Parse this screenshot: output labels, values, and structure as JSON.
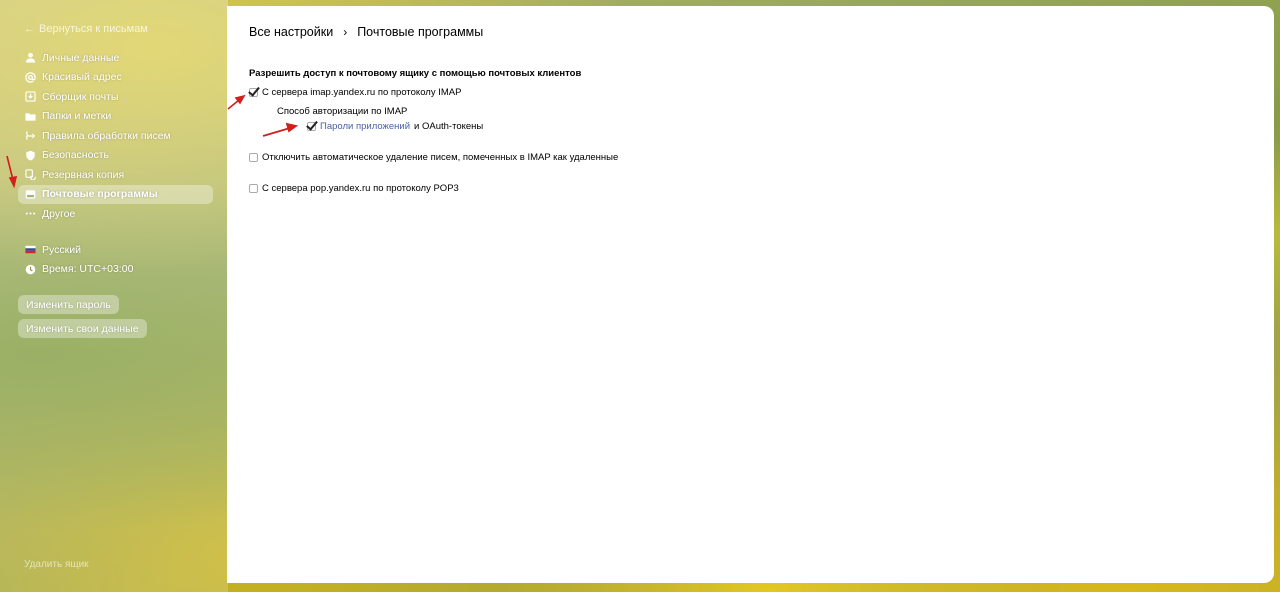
{
  "sidebar": {
    "back_label": "Вернуться к письмам",
    "items": [
      {
        "label": "Личные данные",
        "icon": "user-icon"
      },
      {
        "label": "Красивый адрес",
        "icon": "at-icon"
      },
      {
        "label": "Сборщик почты",
        "icon": "collector-icon"
      },
      {
        "label": "Папки и метки",
        "icon": "folder-icon"
      },
      {
        "label": "Правила обработки писем",
        "icon": "rules-icon"
      },
      {
        "label": "Безопасность",
        "icon": "shield-icon"
      },
      {
        "label": "Резервная копия",
        "icon": "backup-icon"
      },
      {
        "label": "Почтовые программы",
        "icon": "mail-programs-icon",
        "active": true
      },
      {
        "label": "Другое",
        "icon": "more-icon"
      }
    ],
    "language": "Русский",
    "time": "Время: UTC+03:00",
    "change_password": "Изменить пароль",
    "change_data": "Изменить свои данные",
    "delete_mailbox": "Удалить ящик"
  },
  "breadcrumb": {
    "root": "Все настройки",
    "current": "Почтовые программы"
  },
  "settings": {
    "section_title": "Разрешить доступ к почтовому ящику с помощью почтовых клиентов",
    "imap_label": "С сервера imap.yandex.ru по протоколу IMAP",
    "imap_checked": true,
    "auth_method_label": "Способ авторизации по IMAP",
    "app_passwords_link": "Пароли приложений",
    "oauth_suffix": "и OAuth-токены",
    "app_passwords_checked": true,
    "disable_autodelete_label": "Отключить автоматическое удаление писем, помеченных в IMAP как удаленные",
    "disable_autodelete_checked": false,
    "pop3_label": "С сервера pop.yandex.ru по протоколу POP3",
    "pop3_checked": false
  },
  "colors": {
    "annotation_arrow": "#d0201c",
    "link": "#4a5fa6"
  }
}
